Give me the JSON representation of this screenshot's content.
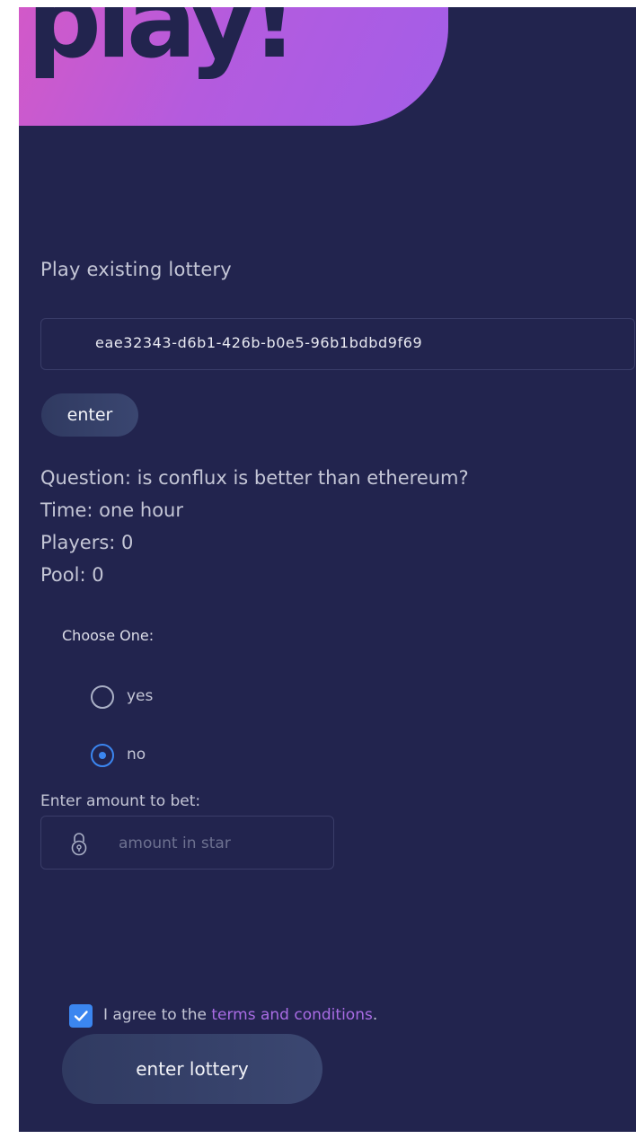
{
  "header": {
    "title": "play!"
  },
  "play_existing": {
    "title": "Play existing lottery",
    "lottery_id_value": "eae32343-d6b1-426b-b0e5-96b1bdbd9f69",
    "enter_label": "enter"
  },
  "lottery_info": {
    "question": "Question: is conflux is better than ethereum?",
    "time": "Time: one hour",
    "players": "Players: 0",
    "pool": "Pool: 0"
  },
  "choice": {
    "label": "Choose One:",
    "options": [
      {
        "label": "yes",
        "selected": false
      },
      {
        "label": "no",
        "selected": true
      }
    ]
  },
  "bet": {
    "label": "Enter amount to bet:",
    "placeholder": "amount in star",
    "icon": "lock-icon"
  },
  "agreement": {
    "checked": true,
    "text_before": "I agree to the ",
    "link_text": "terms and conditions",
    "text_after": "."
  },
  "submit": {
    "label": "enter lottery"
  },
  "colors": {
    "background": "#22244e",
    "hero_gradient_start": "#d259c8",
    "hero_gradient_end": "#a35ee8",
    "accent_blue": "#3b86f0",
    "link_purple": "#a96ce4",
    "button_bg": "#333d65"
  }
}
